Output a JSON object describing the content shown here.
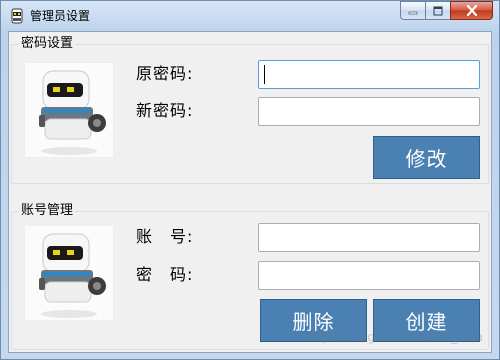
{
  "window": {
    "title": "管理员设置",
    "caption_buttons": {
      "minimize_icon": "minimize-icon",
      "maximize_icon": "maximize-icon",
      "close_icon": "close-icon"
    }
  },
  "password_section": {
    "legend": "密码设置",
    "avatar_icon": "robot-icon",
    "old_password_label": "原密码:",
    "new_password_label": "新密码:",
    "old_password_value": "",
    "new_password_value": "",
    "modify_button": "修改"
  },
  "account_section": {
    "legend": "账号管理",
    "avatar_icon": "robot-icon",
    "account_label": "账　号:",
    "password_label": "密　码:",
    "account_value": "",
    "password_value": "",
    "delete_button": "删除",
    "create_button": "创建"
  },
  "watermark": "https://blog.csdn.net/Ou_tsea",
  "colors": {
    "button_bg": "#4a80b2",
    "window_frame": "#c7d8ee",
    "client_bg": "#f0f0f0"
  }
}
